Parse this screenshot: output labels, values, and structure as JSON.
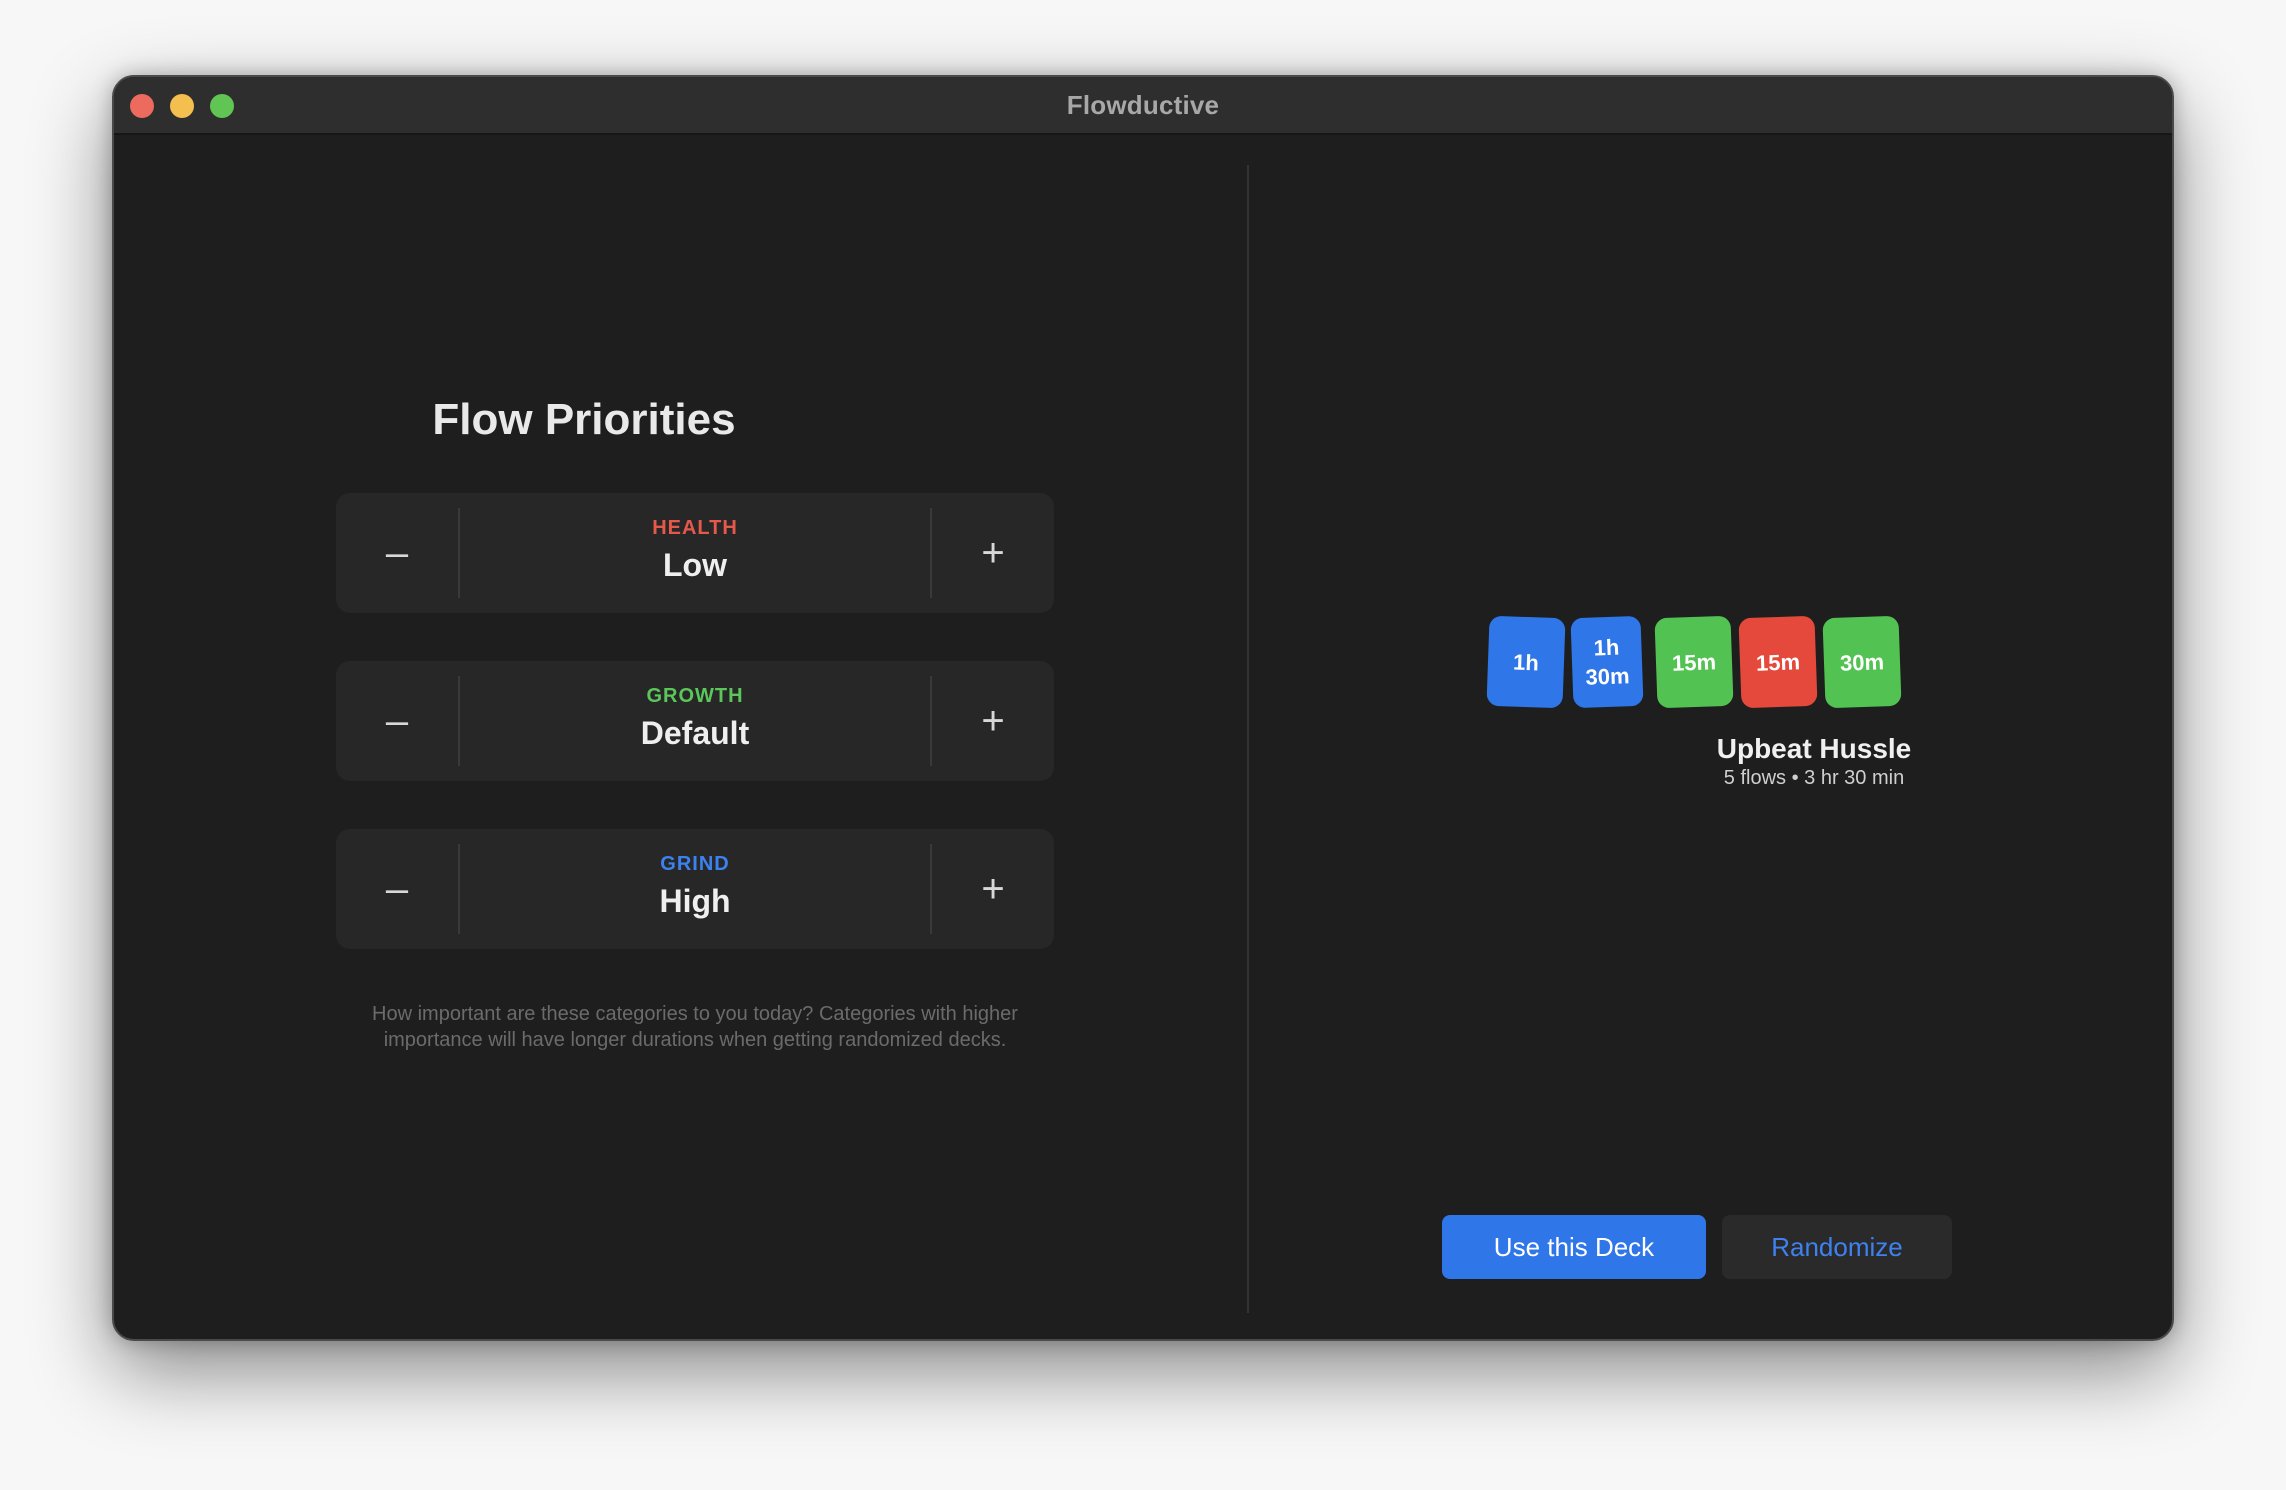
{
  "window": {
    "title": "Flowductive"
  },
  "priorities": {
    "title": "Flow Priorities",
    "decrement_symbol": "–",
    "increment_symbol": "+",
    "items": [
      {
        "category": "HEALTH",
        "value": "Low",
        "color": "#e5584a"
      },
      {
        "category": "GROWTH",
        "value": "Default",
        "color": "#5bc65a"
      },
      {
        "category": "GRIND",
        "value": "High",
        "color": "#3b82f0"
      }
    ],
    "helper_text": "How important are these categories to you today? Categories with higher importance will have longer durations when getting randomized decks."
  },
  "deck": {
    "cards": [
      {
        "label": "1h",
        "color": "#2f76e8"
      },
      {
        "label": "1h 30m",
        "color": "#2f76e8"
      },
      {
        "label": "15m",
        "color": "#52c352"
      },
      {
        "label": "15m",
        "color": "#e5493c"
      },
      {
        "label": "30m",
        "color": "#52c352"
      }
    ],
    "name": "Upbeat Hussle",
    "meta": "5 flows • 3 hr 30 min"
  },
  "actions": {
    "use_deck_label": "Use this Deck",
    "randomize_label": "Randomize"
  },
  "colors": {
    "accent": "#2f76e8",
    "window_bg": "#1e1e1e",
    "titlebar_bg": "#2e2e2e"
  }
}
